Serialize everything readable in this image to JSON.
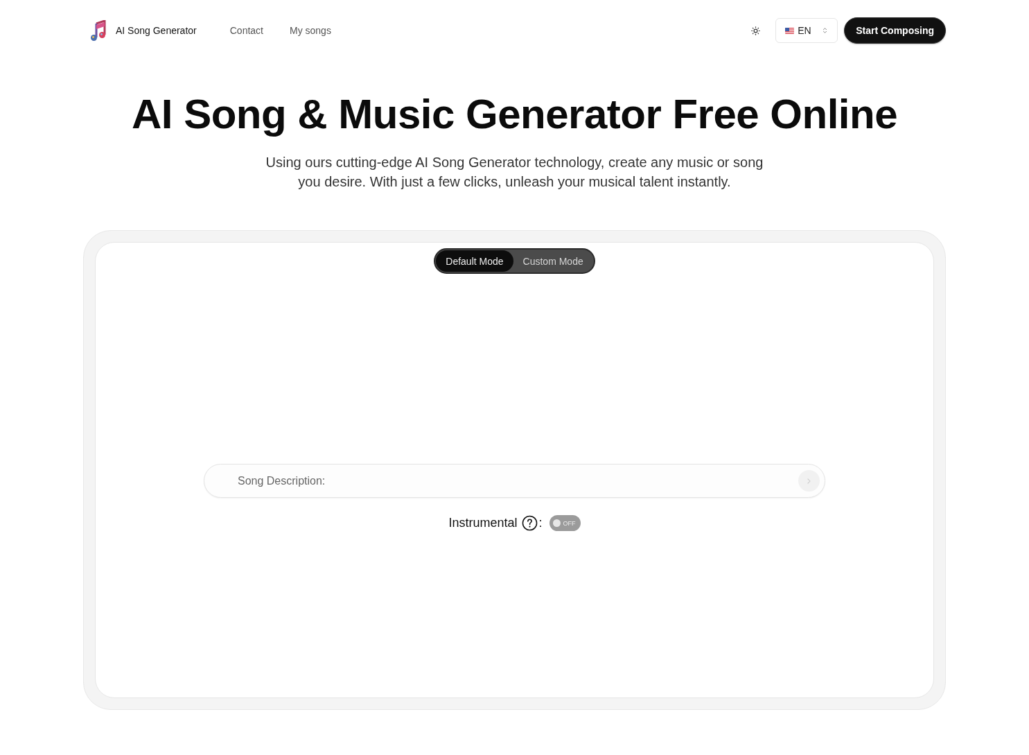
{
  "header": {
    "brand": "AI Song Generator",
    "nav": [
      {
        "label": "Contact"
      },
      {
        "label": "My songs"
      }
    ],
    "language": "EN",
    "cta": "Start Composing"
  },
  "hero": {
    "title": "AI Song & Music Generator Free Online",
    "subtitle": "Using ours cutting-edge AI Song Generator technology, create any music or song you desire. With just a few clicks, unleash your musical talent instantly."
  },
  "composer": {
    "modes": [
      {
        "label": "Default Mode",
        "selected": true
      },
      {
        "label": "Custom Mode",
        "selected": false
      }
    ],
    "description": {
      "placeholder": "Song Description:"
    },
    "instrumental": {
      "label": "Instrumental",
      "separator": ":",
      "on": false,
      "switch_text": "OFF"
    }
  }
}
